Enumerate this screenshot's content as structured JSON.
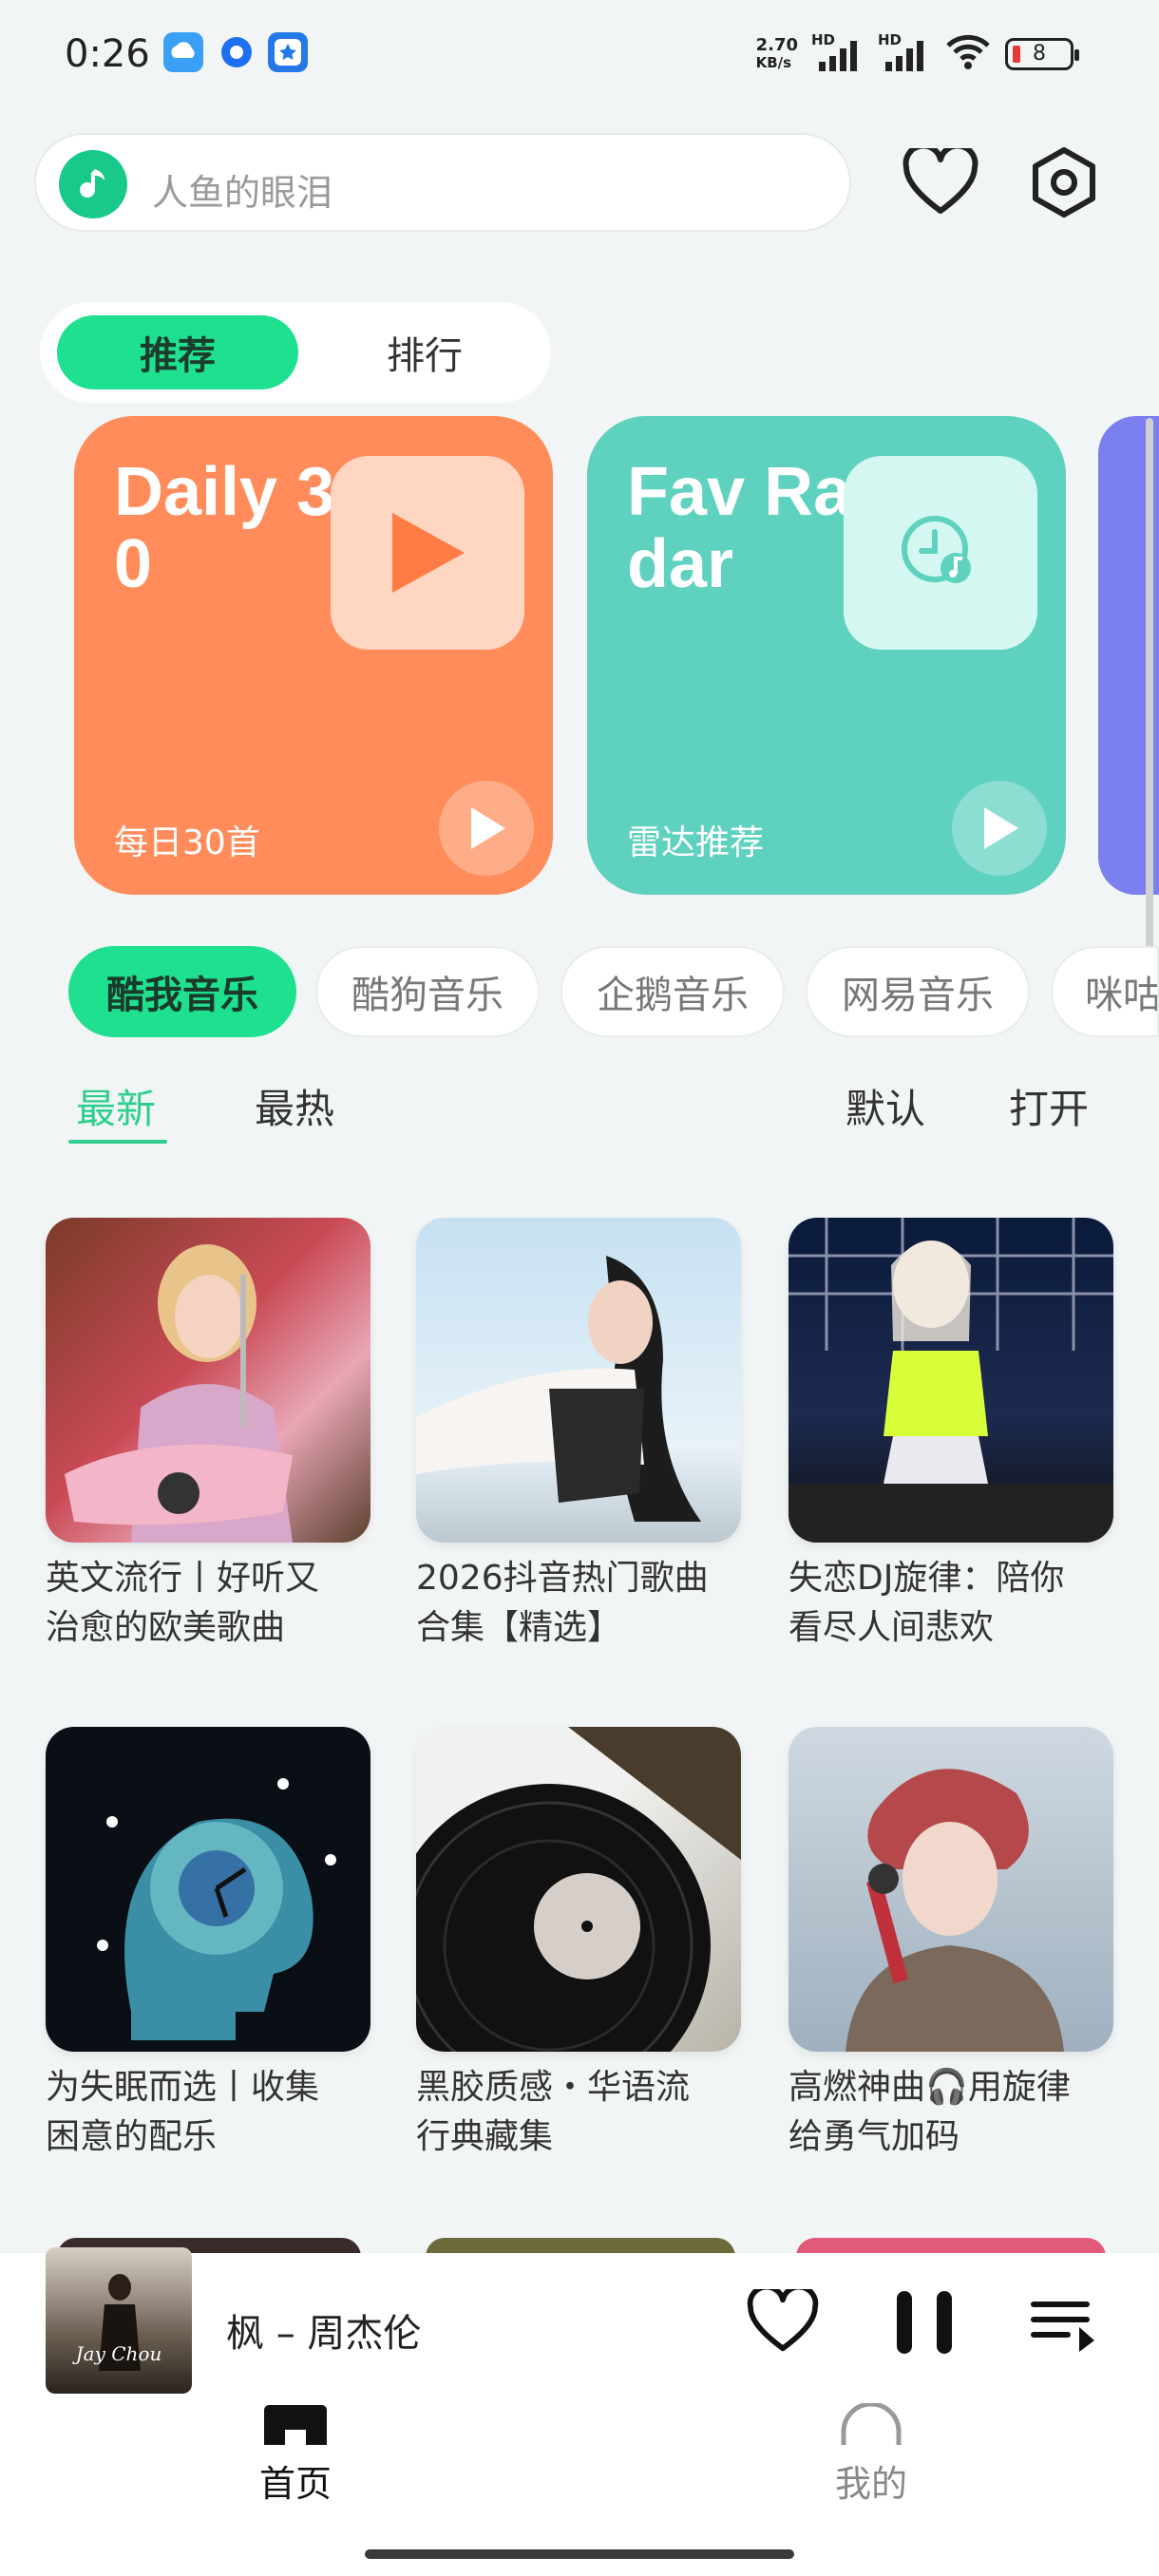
{
  "status": {
    "time": "0:26",
    "net_speed_top": "2.70",
    "net_speed_bottom": "KB/s",
    "hd1": "HD",
    "hd2": "HD",
    "battery": "8"
  },
  "search": {
    "placeholder": "人鱼的眼泪"
  },
  "tabs": [
    {
      "label": "推荐",
      "active": true
    },
    {
      "label": "排行",
      "active": false
    }
  ],
  "feature_cards": [
    {
      "title": "Daily 30",
      "subtitle": "每日30首",
      "color": "#ff8c5a"
    },
    {
      "title": "Fav Radar",
      "subtitle": "雷达推荐",
      "color": "#5fd1bf"
    }
  ],
  "sources": [
    {
      "label": "酷我音乐",
      "active": true
    },
    {
      "label": "酷狗音乐",
      "active": false
    },
    {
      "label": "企鹅音乐",
      "active": false
    },
    {
      "label": "网易音乐",
      "active": false
    },
    {
      "label": "咪咕",
      "active": false
    }
  ],
  "sort": {
    "newest": "最新",
    "hottest": "最热",
    "default": "默认",
    "open": "打开"
  },
  "playlists": [
    {
      "line1": "英文流行丨好听又",
      "line2": "治愈的欧美歌曲"
    },
    {
      "line1": "2026抖音热门歌曲",
      "line2": "合集【精选】"
    },
    {
      "line1": "失恋DJ旋律：陪你",
      "line2": "看尽人间悲欢"
    },
    {
      "line1": "为失眠而选丨收集",
      "line2": "困意的配乐"
    },
    {
      "line1": "黑胶质感・华语流",
      "line2": "行典藏集"
    },
    {
      "line1": "高燃神曲🎧用旋律",
      "line2": "给勇气加码"
    }
  ],
  "player": {
    "now_playing": "枫 – 周杰伦",
    "cover_text": "Jay Chou"
  },
  "bottom_nav": [
    {
      "label": "首页",
      "active": true
    },
    {
      "label": "我的",
      "active": false
    }
  ],
  "colors": {
    "accent": "#1fe08e",
    "accent_text": "#2ecf8e",
    "background": "#f2f5f6"
  }
}
